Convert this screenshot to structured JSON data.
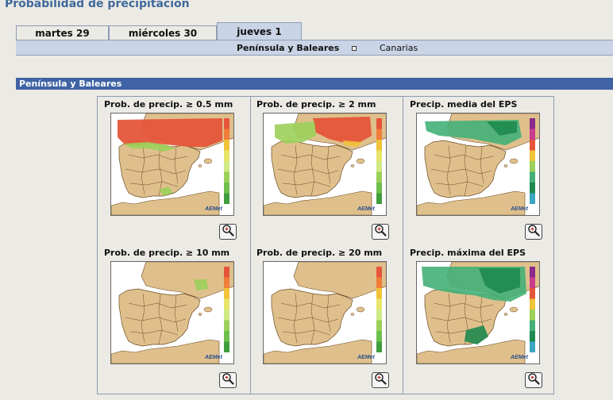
{
  "page": {
    "title": "Probabilidad de precipitación"
  },
  "tabs": [
    {
      "label": "martes 29",
      "active": false
    },
    {
      "label": "miércoles 30",
      "active": false
    },
    {
      "label": "jueves 1",
      "active": true
    }
  ],
  "subnav": [
    {
      "label": "Península y Baleares",
      "selected": true
    },
    {
      "label": "Canarias",
      "selected": false
    }
  ],
  "section": {
    "title": "Península y Baleares"
  },
  "panels": [
    {
      "title": "Prob. de precip.  ≥ 0.5 mm",
      "overlay": "p05",
      "scale": "prob"
    },
    {
      "title": "Prob. de precip.  ≥ 2 mm",
      "overlay": "p2",
      "scale": "prob"
    },
    {
      "title": "Precip.  media del EPS",
      "overlay": "media",
      "scale": "amount"
    },
    {
      "title": "Prob. de precip.  ≥ 10 mm",
      "overlay": "p10",
      "scale": "prob"
    },
    {
      "title": "Prob. de precip.  ≥ 20 mm",
      "overlay": "p20",
      "scale": "prob"
    },
    {
      "title": "Precip.  máxima del EPS",
      "overlay": "max",
      "scale": "amount"
    }
  ],
  "map": {
    "logo": "AEMet"
  },
  "icons": {
    "zoom": "zoom-in-icon"
  },
  "colors": {
    "header": "#3f63a4",
    "title": "#3f6a9c",
    "subbar": "#c9d4e6",
    "land": "#dfc08c",
    "sea": "#ffffff"
  }
}
